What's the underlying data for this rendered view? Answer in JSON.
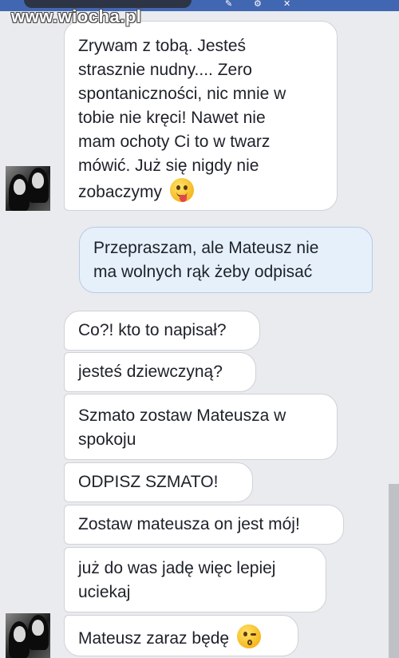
{
  "watermark": "www.wiocha.pl",
  "colors": {
    "background": "#e9ebee",
    "incoming_bubble": "#ffffff",
    "outgoing_bubble": "#e6f0fb",
    "topbar": "#4267b2"
  },
  "messages": [
    {
      "from": "contact",
      "lines": [
        "Zrywam z tobą. Jesteś",
        "strasznie nudny.... Zero",
        "spontaniczności, nic mnie w",
        "tobie nie kręci! Nawet nie",
        "mam ochoty Ci to w twarz",
        "mówić. Już się nigdy nie",
        "zobaczymy"
      ],
      "emoji": "tongue-face-icon"
    },
    {
      "from": "me",
      "lines": [
        "Przepraszam, ale Mateusz nie",
        "ma wolnych rąk żeby odpisać"
      ]
    },
    {
      "from": "contact",
      "lines": [
        "Co?! kto to napisał?"
      ]
    },
    {
      "from": "contact",
      "lines": [
        "jesteś dziewczyną?"
      ]
    },
    {
      "from": "contact",
      "lines": [
        "Szmato zostaw Mateusza w",
        "spokoju"
      ]
    },
    {
      "from": "contact",
      "lines": [
        "ODPISZ SZMATO!"
      ]
    },
    {
      "from": "contact",
      "lines": [
        "Zostaw mateusza on jest mój!"
      ]
    },
    {
      "from": "contact",
      "lines": [
        "już do was jadę więc lepiej",
        "uciekaj"
      ]
    },
    {
      "from": "contact",
      "lines": [
        "Mateusz zaraz będę"
      ],
      "emoji": "kiss-face-icon"
    }
  ]
}
